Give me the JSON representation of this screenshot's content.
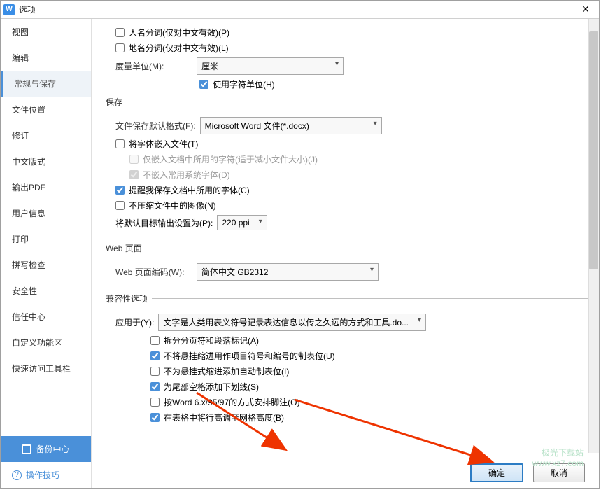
{
  "window": {
    "title": "选项",
    "logo": "W"
  },
  "nav": {
    "items": [
      "视图",
      "编辑",
      "常规与保存",
      "文件位置",
      "修订",
      "中文版式",
      "输出PDF",
      "用户信息",
      "打印",
      "拼写检查",
      "安全性",
      "信任中心",
      "自定义功能区",
      "快速访问工具栏"
    ],
    "active": 2
  },
  "backup": {
    "label": "备份中心"
  },
  "tips": {
    "label": "操作技巧"
  },
  "top": {
    "name": "人名分词(仅对中文有效)(P)",
    "place": "地名分词(仅对中文有效)(L)",
    "unit_lbl": "度量单位(M):",
    "unit_val": "厘米",
    "use_char": "使用字符单位(H)"
  },
  "save": {
    "legend": "保存",
    "fmt_lbl": "文件保存默认格式(F):",
    "fmt_val": "Microsoft Word 文件(*.docx)",
    "embed": "将字体嵌入文件(T)",
    "embed_only": "仅嵌入文档中所用的字符(适于减小文件大小)(J)",
    "embed_nosys": "不嵌入常用系统字体(D)",
    "remind": "提醒我保存文档中所用的字体(C)",
    "nocompress": "不压缩文件中的图像(N)",
    "ppi_lbl": "将默认目标输出设置为(P):",
    "ppi_val": "220 ppi"
  },
  "web": {
    "legend": "Web 页面",
    "enc_lbl": "Web 页面编码(W):",
    "enc_val": "简体中文 GB2312"
  },
  "compat": {
    "legend": "兼容性选项",
    "apply_lbl": "应用于(Y):",
    "apply_val": "文字是人类用表义符号记录表达信息以传之久远的方式和工具.do...",
    "o1": "拆分分页符和段落标记(A)",
    "o2": "不将悬挂缩进用作项目符号和编号的制表位(U)",
    "o3": "不为悬挂式缩进添加自动制表位(I)",
    "o4": "为尾部空格添加下划线(S)",
    "o5": "按Word 6.x/95/97的方式安排脚注(O)",
    "o6": "在表格中将行高调至网格高度(B)"
  },
  "buttons": {
    "ok": "确定",
    "cancel": "取消"
  },
  "watermark": {
    "l1": "极光下载站",
    "l2": "www.xz7.com"
  }
}
